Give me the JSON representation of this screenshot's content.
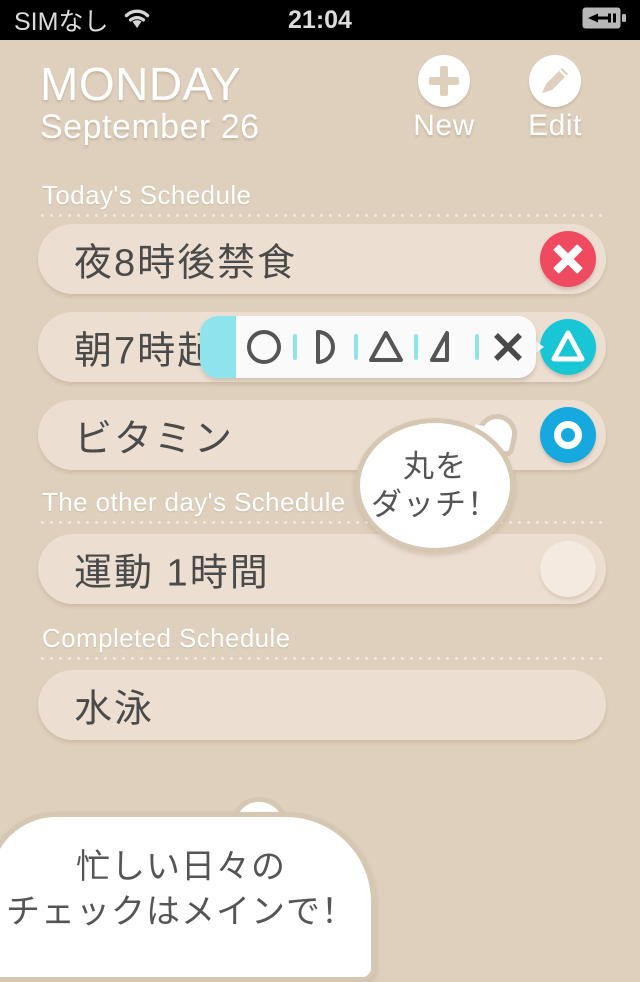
{
  "statusbar": {
    "carrier": "SIMなし",
    "time": "21:04",
    "wifi_icon": "wifi-icon",
    "battery_icon": "battery-charging-icon"
  },
  "header": {
    "day": "MONDAY",
    "date": "September  26",
    "new_label": "New",
    "new_icon": "plus-circle-icon",
    "edit_label": "Edit",
    "edit_icon": "pencil-circle-icon"
  },
  "sections": [
    {
      "title": "Today's Schedule",
      "rows": [
        {
          "text": "夜8時後禁食",
          "status": "x",
          "status_color": "#f04a60"
        },
        {
          "text": "朝7時起き",
          "status": "triangle",
          "status_color": "#18c6d6"
        },
        {
          "text": "ビタミン",
          "status": "circle",
          "status_color": "#15a9e0"
        }
      ]
    },
    {
      "title": "The other day's Schedule",
      "rows": [
        {
          "text": "運動 1時間",
          "status": "none",
          "status_color": "#f4eadf"
        }
      ]
    },
    {
      "title": "Completed Schedule",
      "rows": [
        {
          "text": "水泳",
          "status": "hidden",
          "status_color": ""
        }
      ]
    }
  ],
  "popup": {
    "symbols": [
      "circle",
      "half-circle",
      "triangle",
      "half-triangle",
      "cross"
    ],
    "highlight_color": "#8fe3ec",
    "background": "#fafafa"
  },
  "bubbles": {
    "middle": {
      "line1": "丸を",
      "line2": "ダッチ！"
    },
    "bottom": {
      "line1": "忙しい日々の",
      "line2": "チェックはメインで！"
    }
  },
  "colors": {
    "page_background": "#ded0bd",
    "card": "#ecdfd2",
    "accent_cyan": "#18c6d6",
    "accent_blue": "#15a9e0",
    "accent_red": "#f04a60"
  }
}
